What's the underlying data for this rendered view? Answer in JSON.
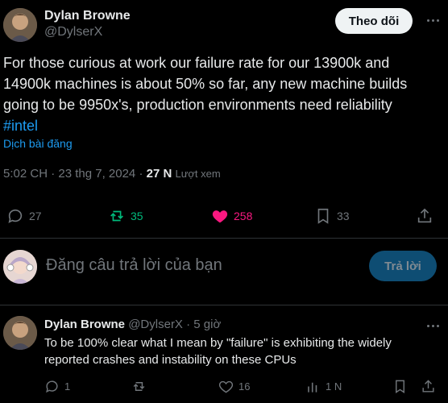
{
  "tweet": {
    "author_name": "Dylan Browne",
    "author_handle": "@DylserX",
    "follow_label": "Theo dõi",
    "text_main": "For those curious at work our failure rate for our 13900k and 14900k machines is about 50% so far, any new machine builds going to be 9950x's, production environments need reliability",
    "hashtag": "#intel",
    "translate_label": "Dịch bài đăng",
    "timestamp": "5:02 CH · 23 thg 7, 2024 ·",
    "views_count": "27 N",
    "views_label": "Lượt xem",
    "actions": {
      "replies": "27",
      "reposts": "35",
      "likes": "258",
      "bookmarks": "33"
    }
  },
  "compose": {
    "placeholder": "Đăng câu trả lời của bạn",
    "reply_button": "Trả lời"
  },
  "reply": {
    "author_name": "Dylan Browne",
    "author_handle": "@DylserX",
    "time": "· 5 giờ",
    "text": "To be 100% clear what I mean by \"failure\" is exhibiting the widely reported crashes and instability on these CPUs",
    "actions": {
      "replies": "1",
      "likes": "16",
      "views": "1 N"
    }
  },
  "colors": {
    "accent": "#1d9bf0",
    "like": "#f91880",
    "repost": "#00ba7c",
    "muted": "#71767b"
  }
}
